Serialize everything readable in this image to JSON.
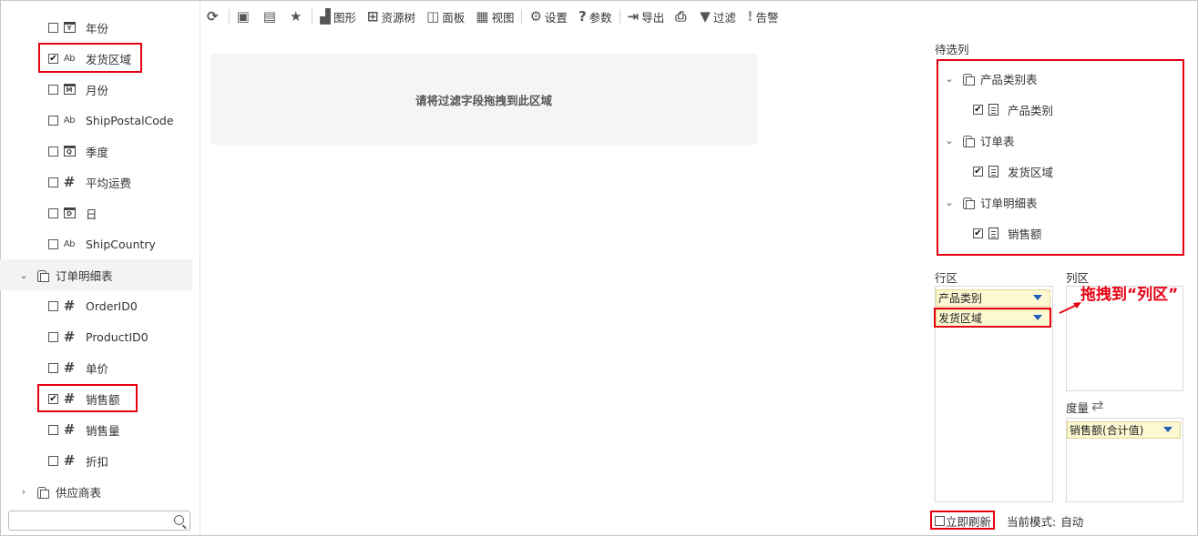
{
  "tree": {
    "fields_a": [
      {
        "label": "年份",
        "type": "date",
        "letter": "Y",
        "checked": false
      },
      {
        "label": "发货区域",
        "type": "text",
        "checked": true
      },
      {
        "label": "月份",
        "type": "date",
        "letter": "M",
        "checked": false
      },
      {
        "label": "ShipPostalCode",
        "type": "text",
        "checked": false
      },
      {
        "label": "季度",
        "type": "date",
        "letter": "Q",
        "checked": false
      },
      {
        "label": "平均运费",
        "type": "number",
        "checked": false
      },
      {
        "label": "日",
        "type": "date",
        "letter": "D",
        "checked": false
      },
      {
        "label": "ShipCountry",
        "type": "text",
        "checked": false
      }
    ],
    "group_order_detail": "订单明细表",
    "fields_b": [
      {
        "label": "OrderID0",
        "type": "number",
        "checked": false
      },
      {
        "label": "ProductID0",
        "type": "number",
        "checked": false
      },
      {
        "label": "单价",
        "type": "number",
        "checked": false
      },
      {
        "label": "销售额",
        "type": "number",
        "checked": true
      },
      {
        "label": "销售量",
        "type": "number",
        "checked": false
      },
      {
        "label": "折扣",
        "type": "number",
        "checked": false
      }
    ],
    "group_supplier": "供应商表",
    "text_glyph": "Ab",
    "number_glyph": "#",
    "check_glyph": "✔"
  },
  "search": {
    "value": "",
    "placeholder": ""
  },
  "toolbar": {
    "graph": "图形",
    "resource_tree": "资源树",
    "panel": "面板",
    "view": "视图",
    "settings": "设置",
    "params": "参数",
    "export": "导出",
    "filter": "过滤",
    "alert": "告警"
  },
  "dropzone": {
    "hint": "请将过滤字段拖拽到此区域"
  },
  "right": {
    "candidate_title": "待选列",
    "candidates": [
      {
        "table": "产品类别表",
        "field": "产品类别"
      },
      {
        "table": "订单表",
        "field": "发货区域"
      },
      {
        "table": "订单明细表",
        "field": "销售额"
      }
    ],
    "row_zone_title": "行区",
    "col_zone_title": "列区",
    "measure_title": "度量",
    "row_pills": [
      "产品类别",
      "发货区域"
    ],
    "measure_pill": "销售额(合计值)",
    "annotation": "拖拽到“列区”",
    "refresh_now": "立即刷新",
    "mode_label": "当前模式:",
    "mode_value": "自动"
  },
  "colors": {
    "highlight": "#e60012",
    "pill_bg": "#fdf8d2",
    "dropdown": "#1f5fb4"
  }
}
